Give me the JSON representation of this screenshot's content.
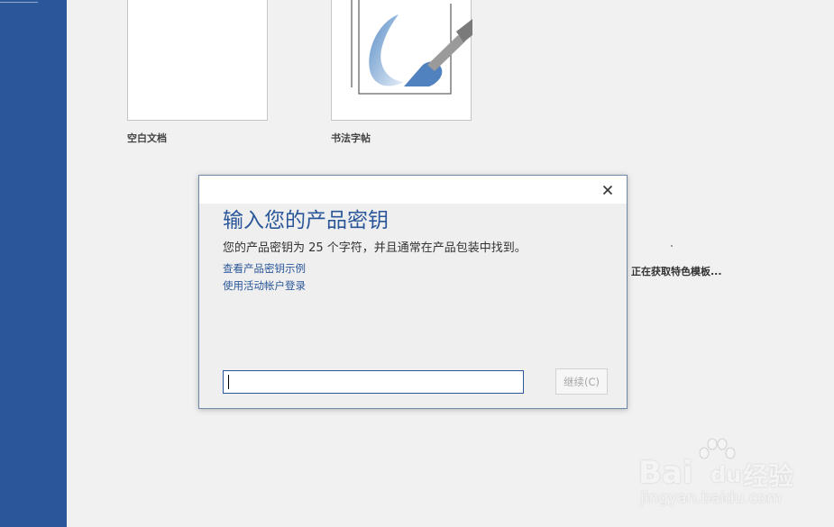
{
  "templates": [
    {
      "label": "空白文档",
      "icon": "blank-document-thumbnail"
    },
    {
      "label": "书法字帖",
      "icon": "calligraphy-brush-icon"
    }
  ],
  "loading_text": "正在获取特色模板...",
  "dialog": {
    "title": "输入您的产品密钥",
    "description": "您的产品密钥为 25 个字符，并且通常在产品包装中找到。",
    "links": [
      "查看产品密钥示例",
      "使用活动帐户登录"
    ],
    "input_value": "",
    "continue_label": "继续(C)",
    "close_icon": "close-icon"
  },
  "watermark": {
    "brand": "Bai",
    "brand_suffix": "du",
    "brand_cn": "经验",
    "url": "jingyan.baidu.com"
  },
  "colors": {
    "sidebar": "#2b579a",
    "accent": "#2b579a",
    "background": "#f1f1f1"
  }
}
